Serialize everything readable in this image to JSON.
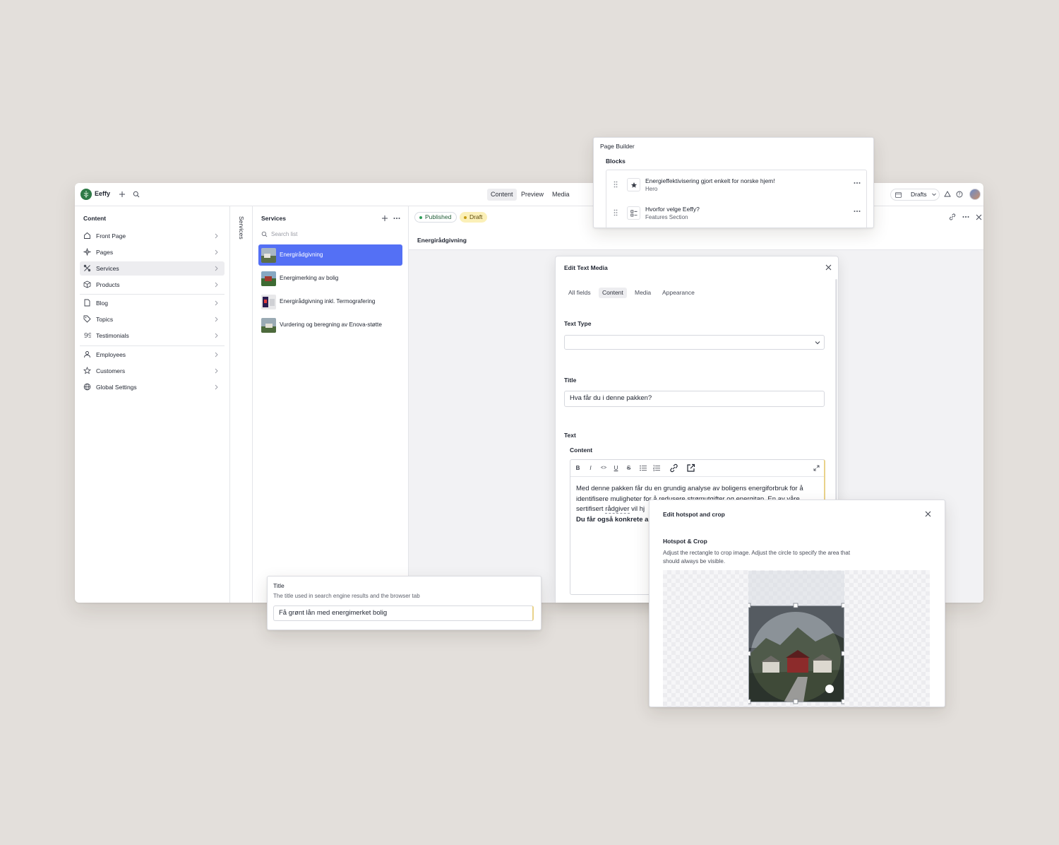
{
  "app": {
    "brand": "Eeffy",
    "nav_tabs": [
      "Content",
      "Preview",
      "Media"
    ],
    "active_tab": "Content",
    "perspective": "Drafts"
  },
  "content_pane": {
    "title": "Content",
    "items": [
      {
        "label": "Front Page",
        "icon": "home-icon"
      },
      {
        "label": "Pages",
        "icon": "pages-icon"
      },
      {
        "label": "Services",
        "icon": "services-icon",
        "active": true
      },
      {
        "label": "Products",
        "icon": "package-icon"
      },
      {
        "label": "Blog",
        "icon": "document-icon"
      },
      {
        "label": "Topics",
        "icon": "tag-icon"
      },
      {
        "label": "Testimonials",
        "icon": "quote-icon"
      },
      {
        "label": "Employees",
        "icon": "user-icon"
      },
      {
        "label": "Customers",
        "icon": "star-icon"
      },
      {
        "label": "Global Settings",
        "icon": "globe-icon"
      }
    ]
  },
  "collapsed_pane": {
    "label": "Services"
  },
  "services_pane": {
    "title": "Services",
    "search_placeholder": "Search list",
    "items": [
      {
        "label": "Energirådgivning",
        "selected": true
      },
      {
        "label": "Energimerking av bolig"
      },
      {
        "label": "Energirådgivning inkl. Termografering"
      },
      {
        "label": "Vurdering og beregning av Enova-støtte"
      }
    ]
  },
  "document": {
    "status_published": "Published",
    "status_draft": "Draft",
    "title": "Energirådgivning"
  },
  "edit_text_media": {
    "title": "Edit Text Media",
    "tabs": [
      "All fields",
      "Content",
      "Media",
      "Appearance"
    ],
    "active_tab": "Content",
    "text_type_label": "Text Type",
    "text_type_value": "",
    "title_label": "Title",
    "title_value": "Hva får du i denne pakken?",
    "text_label": "Text",
    "content_label": "Content",
    "toolbar": [
      "B",
      "I",
      "<>",
      "U",
      "S"
    ],
    "body_line1": "Med denne pakken får du en grundig analyse av boligens energiforbruk for å",
    "body_line2": "identifisere muligheter for å redusere strømutgifter og energitap. En av våre",
    "body_line3_pre": "sertifisert ",
    "body_line3_link": "rådgiver",
    "body_line3_post": " vil hj",
    "body_line4_bold": "Du får også konkrete a"
  },
  "page_builder": {
    "title": "Page Builder",
    "blocks_label": "Blocks",
    "blocks": [
      {
        "title": "Energieffektivisering gjort enkelt for norske hjem!",
        "type": "Hero",
        "icon": "star-icon"
      },
      {
        "title": "Hvorfor velge Eeffy?",
        "type": "Features Section",
        "icon": "features-icon"
      }
    ]
  },
  "seo_title": {
    "label": "Title",
    "description": "The title used in search engine results and the browser tab",
    "value": "Få grønt lån med energimerket bolig"
  },
  "hotspot": {
    "title": "Edit hotspot and crop",
    "section_label": "Hotspot & Crop",
    "description_line1": "Adjust the rectangle to crop image. Adjust the circle to specify the area that",
    "description_line2": "should always be visible."
  },
  "colors": {
    "accent": "#5470f5",
    "published": "#2f9e5a",
    "draft_bg": "#fbf0b8",
    "background": "#e3dfdb"
  }
}
